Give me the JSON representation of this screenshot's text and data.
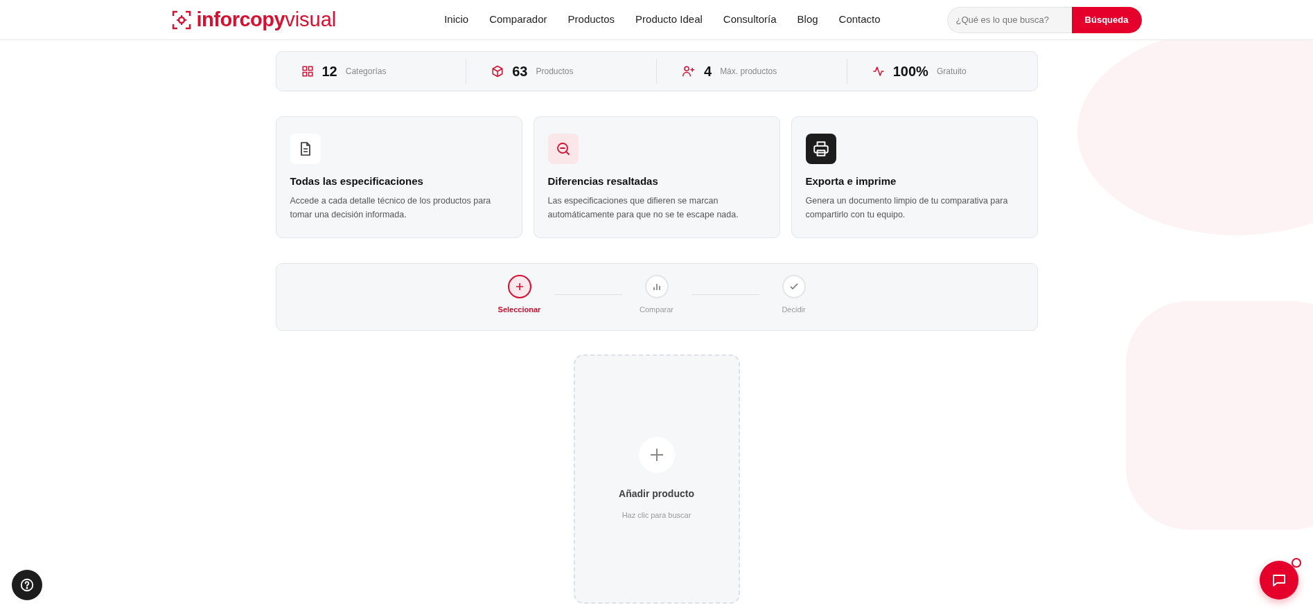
{
  "header": {
    "logo": {
      "bold": "inforcopy",
      "light": "visual"
    },
    "nav": [
      {
        "label": "Inicio"
      },
      {
        "label": "Comparador"
      },
      {
        "label": "Productos"
      },
      {
        "label": "Producto Ideal"
      },
      {
        "label": "Consultoría"
      },
      {
        "label": "Blog"
      },
      {
        "label": "Contacto"
      }
    ],
    "search": {
      "placeholder": "¿Qué es lo que busca?",
      "button": "Búsqueda"
    }
  },
  "stats": [
    {
      "value": "12",
      "label": "Categorías"
    },
    {
      "value": "63",
      "label": "Productos"
    },
    {
      "value": "4",
      "label": "Máx. productos"
    },
    {
      "value": "100%",
      "label": "Gratuito"
    }
  ],
  "features": [
    {
      "kind": "light",
      "title": "Todas las especificaciones",
      "text": "Accede a cada detalle técnico de los productos para tomar una decisión informada."
    },
    {
      "kind": "tinted",
      "title": "Diferencias resaltadas",
      "text": "Las especificaciones que difieren se marcan automáticamente para que no se te escape nada."
    },
    {
      "kind": "dark",
      "title": "Exporta e imprime",
      "text": "Genera un documento limpio de tu comparativa para compartirlo con tu equipo."
    }
  ],
  "steps": [
    {
      "label": "Seleccionar",
      "selected": true
    },
    {
      "label": "Comparar",
      "selected": false
    },
    {
      "label": "Decidir",
      "selected": false
    }
  ],
  "add_card": {
    "title": "Añadir producto",
    "subtitle": "Haz clic para buscar"
  },
  "chat": {
    "notification": true
  }
}
